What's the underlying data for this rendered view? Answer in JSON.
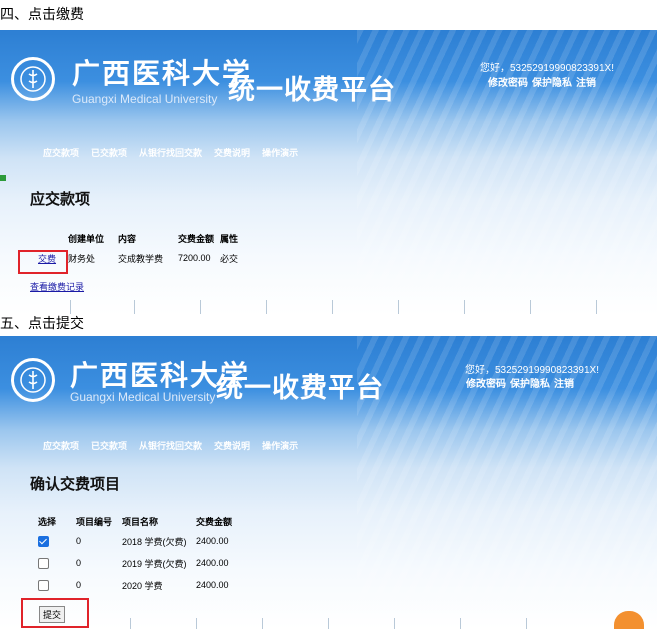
{
  "step4": {
    "title": "四、点击缴费",
    "header": {
      "uni_cn": "广西医科大学",
      "uni_en": "Guangxi Medical University",
      "platform": "统一收费平台",
      "greeting": "您好，53252919990823391X!",
      "links": [
        "修改密码",
        "保护隐私",
        "注销"
      ]
    },
    "nav": [
      "应交款项",
      "已交款项",
      "从银行找回交款",
      "交费说明",
      "操作演示"
    ],
    "section_title": "应交款项",
    "table": {
      "headers": [
        "",
        "创建单位",
        "内容",
        "交费金额",
        "属性"
      ],
      "rows": [
        {
          "action": "交费",
          "unit": "财务处",
          "content": "交成教学费",
          "amount": "7200.00",
          "attr": "必交"
        }
      ]
    },
    "history_link": "查看缴费记录"
  },
  "step5": {
    "title": "五、点击提交",
    "header": {
      "uni_cn": "广西医科大学",
      "uni_en": "Guangxi Medical University",
      "platform": "统一收费平台",
      "greeting": "您好，53252919990823391X!",
      "links": [
        "修改密码",
        "保护隐私",
        "注销"
      ]
    },
    "nav": [
      "应交款项",
      "已交款项",
      "从银行找回交款",
      "交费说明",
      "操作演示"
    ],
    "section_title": "确认交费项目",
    "table": {
      "headers": [
        "选择",
        "项目编号",
        "项目名称",
        "交费金额"
      ],
      "rows": [
        {
          "checked": true,
          "code": "0",
          "name": "2018 学费(欠费)",
          "amount": "2400.00"
        },
        {
          "checked": false,
          "code": "0",
          "name": "2019 学费(欠费)",
          "amount": "2400.00"
        },
        {
          "checked": false,
          "code": "0",
          "name": "2020 学费",
          "amount": "2400.00"
        }
      ]
    },
    "submit_label": "提交"
  },
  "colors": {
    "header_blue": "#2d7fd3",
    "highlight_red": "#e0232a",
    "link_blue": "#1a1aa6"
  },
  "icons": [
    "university-logo-icon",
    "checkbox-icon"
  ]
}
